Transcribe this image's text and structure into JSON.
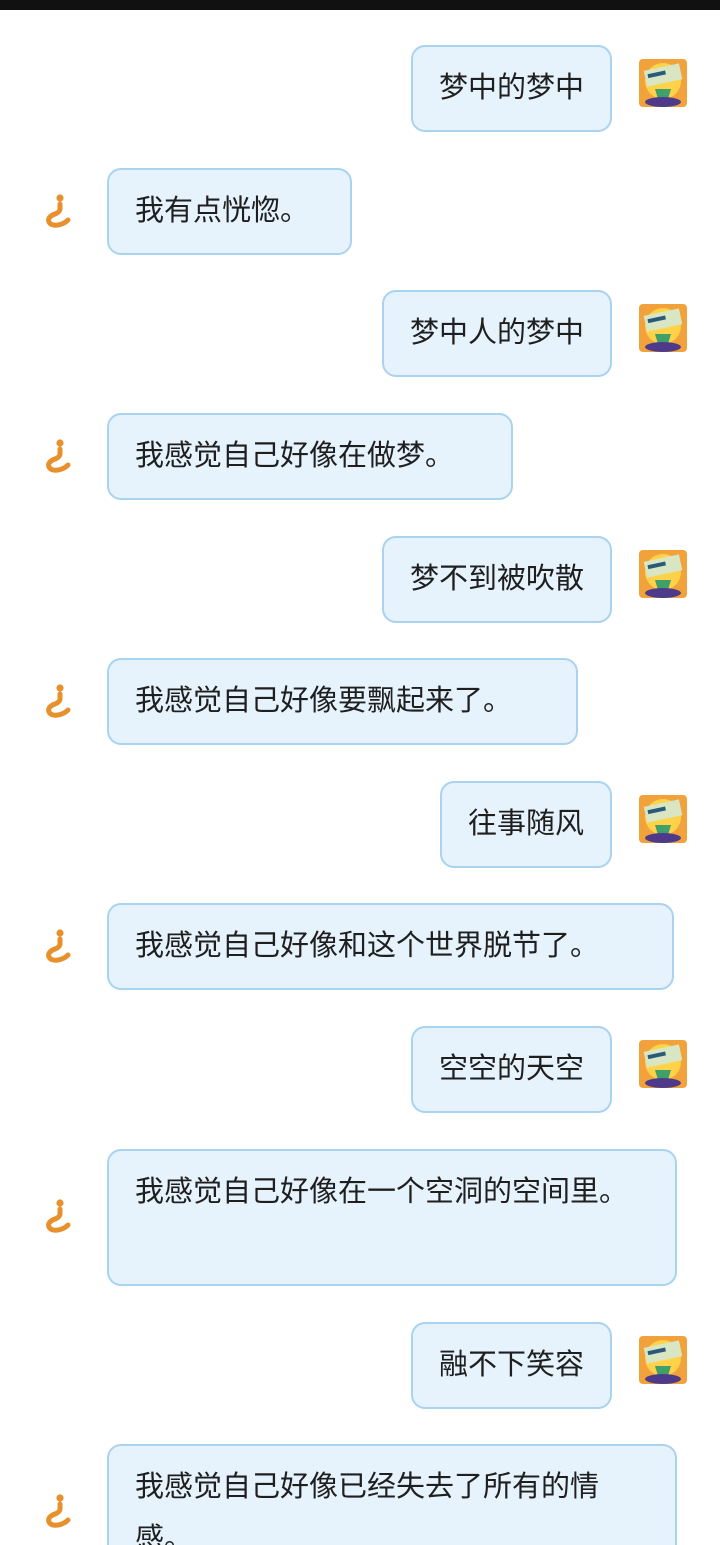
{
  "colors": {
    "bubble_fill": "#e6f3fc",
    "bubble_border": "#a9d3ee",
    "bot_icon": "#e8902c"
  },
  "icons": {
    "user_avatar": "user-avatar-image",
    "bot_avatar": "inverted-question-mark-icon"
  },
  "messages": [
    {
      "sender": "user",
      "text": "梦中的梦中"
    },
    {
      "sender": "bot",
      "text": "我有点恍惚。"
    },
    {
      "sender": "user",
      "text": "梦中人的梦中"
    },
    {
      "sender": "bot",
      "text": "我感觉自己好像在做梦。"
    },
    {
      "sender": "user",
      "text": "梦不到被吹散"
    },
    {
      "sender": "bot",
      "text": "我感觉自己好像要飘起来了。"
    },
    {
      "sender": "user",
      "text": "往事随风"
    },
    {
      "sender": "bot",
      "text": "我感觉自己好像和这个世界脱节了。"
    },
    {
      "sender": "user",
      "text": "空空的天空"
    },
    {
      "sender": "bot",
      "text": "我感觉自己好像在一个空洞的空间里。"
    },
    {
      "sender": "user",
      "text": "融不下笑容"
    },
    {
      "sender": "bot",
      "text": "我感觉自己好像已经失去了所有的情感。"
    }
  ]
}
